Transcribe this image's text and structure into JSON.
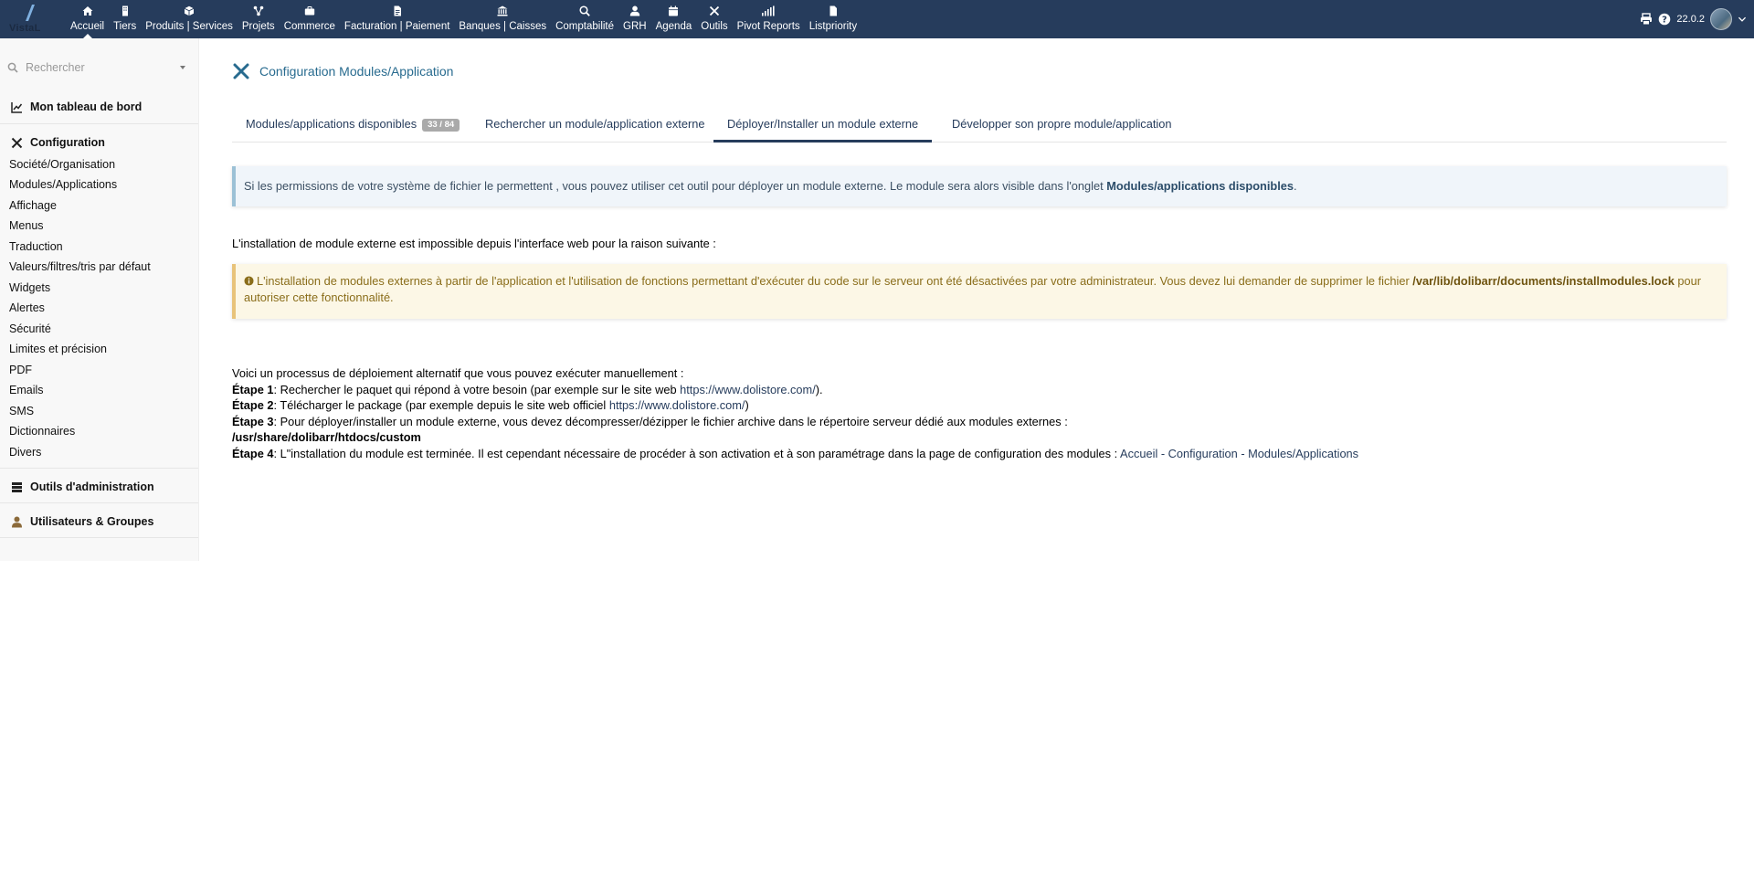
{
  "app": {
    "logo_text": "VistaL",
    "version": "22.0.2"
  },
  "colors": {
    "topbar": "#263c5c",
    "accent": "#286b8f",
    "info_bg": "#f0f5fa",
    "warn_bg": "#fcf7e6",
    "warn_text": "#8a6d1a"
  },
  "topmenu": [
    {
      "label": "Accueil",
      "icon": "home-icon",
      "active": true
    },
    {
      "label": "Tiers",
      "icon": "building-icon"
    },
    {
      "label": "Produits | Services",
      "icon": "cube-icon"
    },
    {
      "label": "Projets",
      "icon": "project-nodes-icon"
    },
    {
      "label": "Commerce",
      "icon": "briefcase-icon"
    },
    {
      "label": "Facturation | Paiement",
      "icon": "invoice-icon"
    },
    {
      "label": "Banques | Caisses",
      "icon": "bank-icon"
    },
    {
      "label": "Comptabilité",
      "icon": "search-dollar-icon"
    },
    {
      "label": "GRH",
      "icon": "user-tie-icon"
    },
    {
      "label": "Agenda",
      "icon": "calendar-icon"
    },
    {
      "label": "Outils",
      "icon": "tools-icon"
    },
    {
      "label": "Pivot Reports",
      "icon": "bar-chart-icon"
    },
    {
      "label": "Listpriority",
      "icon": "file-icon"
    }
  ],
  "sidebar": {
    "search_placeholder": "Rechercher",
    "dashboard": "Mon tableau de bord",
    "configuration": "Configuration",
    "config_items": [
      "Société/Organisation",
      "Modules/Applications",
      "Affichage",
      "Menus",
      "Traduction",
      "Valeurs/filtres/tris par défaut",
      "Widgets",
      "Alertes",
      "Sécurité",
      "Limites et précision",
      "PDF",
      "Emails",
      "SMS",
      "Dictionnaires",
      "Divers"
    ],
    "admin_tools": "Outils d'administration",
    "users_groups": "Utilisateurs & Groupes"
  },
  "page": {
    "title": "Configuration Modules/Application",
    "tabs": [
      {
        "label": "Modules/applications disponibles",
        "badge": "33 / 84"
      },
      {
        "label": "Rechercher un module/application externe"
      },
      {
        "label": "Déployer/Installer un module externe",
        "active": true
      },
      {
        "label": "Développer son propre module/application"
      }
    ],
    "info_text": "Si les permissions de votre système de fichier le permettent , vous pouvez utiliser cet outil pour déployer un module externe. Le module sera alors visible dans l'onglet ",
    "info_bold": "Modules/applications disponibles",
    "info_end": ".",
    "reason_text": "L'installation de module externe est impossible depuis l'interface web pour la raison suivante :",
    "warning_text": "L'installation de modules externes à partir de l'application et l'utilisation de fonctions permettant d'exécuter du code sur le serveur ont été désactivées par votre administrateur. Vous devez lui demander de supprimer le fichier ",
    "warning_bold": "/var/lib/dolibarr/documents/installmodules.lock",
    "warning_end": " pour autoriser cette fonctionnalité.",
    "steps_intro": "Voici un processus de déploiement alternatif que vous pouvez exécuter manuellement :",
    "step1_label": "Étape 1",
    "step1_text": ": Rechercher le paquet qui répond à votre besoin (par exemple sur le site web ",
    "step1_link": "https://www.dolistore.com/",
    "step1_end": ").",
    "step2_label": "Étape 2",
    "step2_text": ": Télécharger le package (par exemple depuis le site web officiel ",
    "step2_link": "https://www.dolistore.com/",
    "step2_end": ")",
    "step3_label": "Étape 3",
    "step3_text": ": Pour déployer/installer un module externe, vous devez décompresser/dézipper le fichier archive dans le répertoire serveur dédié aux modules externes :",
    "step3_path": "/usr/share/dolibarr/htdocs/custom",
    "step4_label": "Étape 4",
    "step4_text": ": L\"installation du module est terminée. Il est cependant nécessaire de procéder à son activation et à son paramétrage dans la page de configuration des modules : ",
    "step4_link": "Accueil - Configuration - Modules/Applications"
  }
}
